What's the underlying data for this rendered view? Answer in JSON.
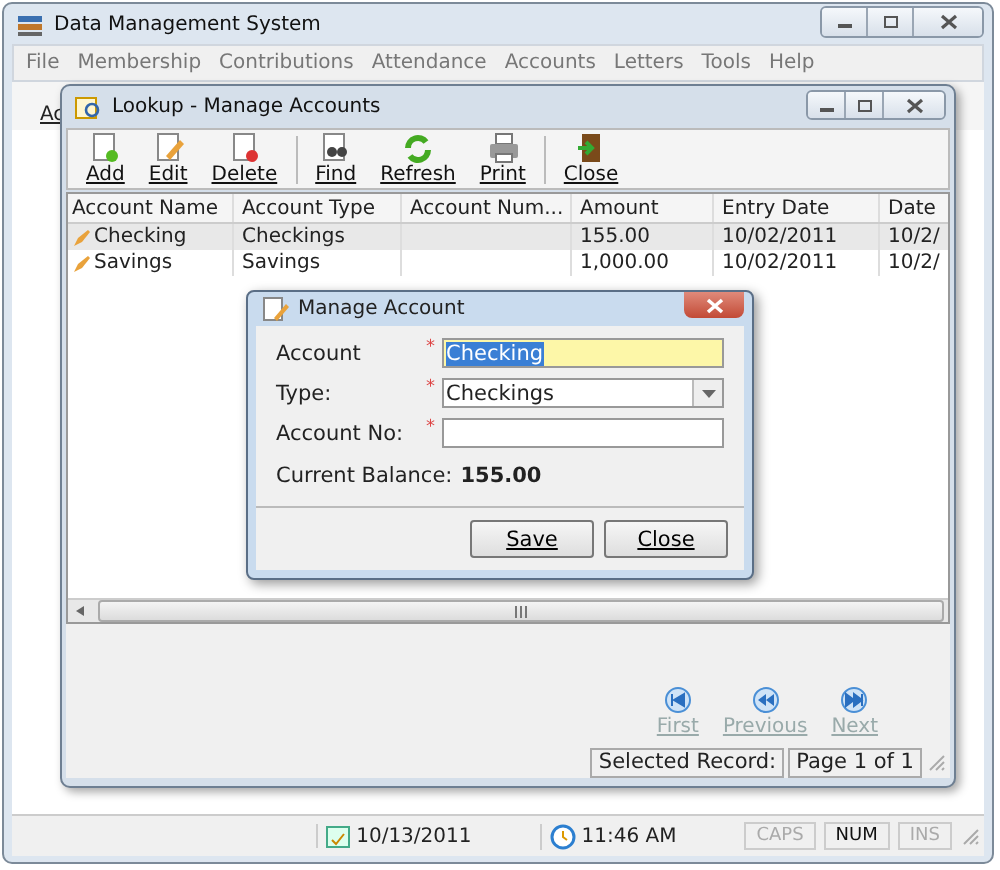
{
  "window": {
    "title": "Data Management System"
  },
  "menu": [
    "File",
    "Membership",
    "Contributions",
    "Attendance",
    "Accounts",
    "Letters",
    "Tools",
    "Help"
  ],
  "main_toolbar": {
    "partial_label": "Ac"
  },
  "lookup": {
    "title": "Lookup - Manage Accounts",
    "toolbar": [
      {
        "label": "Add",
        "kind": "add"
      },
      {
        "label": "Edit",
        "kind": "edit"
      },
      {
        "label": "Delete",
        "kind": "delete"
      },
      {
        "label": "Find",
        "kind": "find",
        "group_start": true
      },
      {
        "label": "Refresh",
        "kind": "refresh"
      },
      {
        "label": "Print",
        "kind": "print"
      },
      {
        "label": "Close",
        "kind": "close",
        "group_start": true
      }
    ],
    "table": {
      "columns": [
        "Account Name",
        "Account Type",
        "Account Num...",
        "Amount",
        "Entry Date",
        "Date"
      ],
      "rows": [
        {
          "selected": true,
          "cells": [
            "Checking",
            "Checkings",
            "",
            "155.00",
            "10/02/2011",
            "10/2/"
          ]
        },
        {
          "selected": false,
          "cells": [
            "Savings",
            "Savings",
            "",
            "1,000.00",
            "10/02/2011",
            "10/2/"
          ]
        }
      ]
    },
    "navigation": [
      {
        "label": "First",
        "kind": "first",
        "disabled": true
      },
      {
        "label": "Previous",
        "kind": "previous",
        "disabled": true
      },
      {
        "label": "Next",
        "kind": "next",
        "disabled": true
      }
    ],
    "status": {
      "label": "Selected Record:",
      "value": "Page 1 of 1"
    }
  },
  "dialog": {
    "title": "Manage Account",
    "fields": [
      {
        "label": "Account",
        "kind": "text",
        "marker": "*",
        "value": "Checking",
        "highlighted": true
      },
      {
        "label": "Type:",
        "kind": "dropdown",
        "marker": "*",
        "value": "Checkings",
        "highlighted": false
      },
      {
        "label": "Account No:",
        "kind": "text",
        "marker": "*",
        "highlighted": false
      }
    ],
    "balance": {
      "label": "Current Balance:",
      "value": "155.00"
    },
    "buttons": [
      "Save",
      "Close"
    ]
  },
  "status_bar": {
    "date": "10/13/2011",
    "time": "11:46 AM",
    "keys": [
      {
        "label": "CAPS",
        "on": false
      },
      {
        "label": "NUM",
        "on": true
      },
      {
        "label": "INS",
        "on": false
      }
    ]
  }
}
